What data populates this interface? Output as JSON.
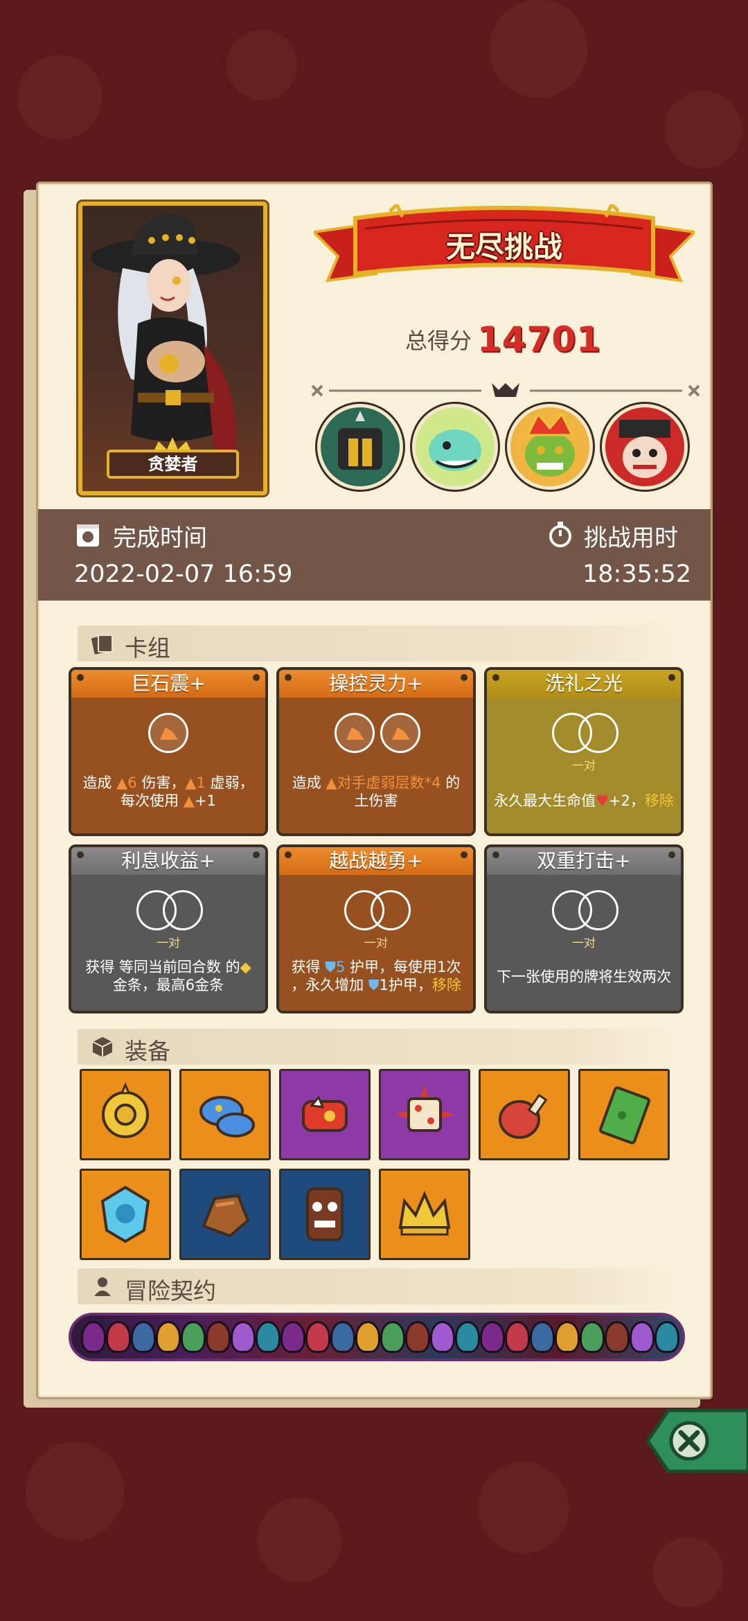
{
  "portrait": {
    "name": "贪婪者"
  },
  "banner": {
    "title": "无尽挑战"
  },
  "score": {
    "label": "总得分",
    "value": "14701"
  },
  "bosses": [
    "boss-helmet",
    "boss-dragon",
    "boss-goblin-king",
    "boss-jester"
  ],
  "time": {
    "finish_label": "完成时间",
    "finish_value": "2022-02-07 16:59",
    "duration_label": "挑战用时",
    "duration_value": "18:35:52"
  },
  "sections": {
    "deck": "卡组",
    "equipment": "装备",
    "contract": "冒险契约"
  },
  "cards": [
    {
      "title": "巨石震+",
      "color": "#97501f",
      "desc1a": "造成 ",
      "desc1b": "6",
      "desc1c": " 伤害，",
      "desc1d": "1",
      "desc1e": " 虚弱，",
      "desc2a": "每次使用 ",
      "desc2b": "+1"
    },
    {
      "title": "操控灵力+",
      "color": "#97501f",
      "desc1a": "造成 ",
      "desc1b": "对手虚弱层数*4",
      "desc1c": " 的",
      "desc2a": "土伤害"
    },
    {
      "title": "洗礼之光",
      "color": "#a38a2a",
      "pair": "一对",
      "desc1a": "永久最大生命值",
      "desc1b": "+2，",
      "desc1c": "移除"
    },
    {
      "title": "利息收益+",
      "color": "#585858",
      "pair": "一对",
      "desc1a": "获得 等同当前回合数 的",
      "desc2a": "金条，最高6金条"
    },
    {
      "title": "越战越勇+",
      "color": "#97501f",
      "pair": "一对",
      "desc1a": "获得 ",
      "desc1b": "5",
      "desc1c": " 护甲，每使用1次",
      "desc2a": "，永久增加 ",
      "desc2b": "1护甲，",
      "desc2c": "移除"
    },
    {
      "title": "双重打击+",
      "color": "#585858",
      "pair": "一对",
      "desc1a": "下一张使用的牌将生效两次"
    }
  ],
  "equipment": [
    "sun-amulet-icon",
    "blue-mushroom-icon",
    "red-bracer-icon",
    "spiked-dice-icon",
    "meat-leg-icon",
    "green-slime-card-icon",
    "ice-gem-icon",
    "rock-icon",
    "tiki-mask-icon",
    "crown-icon"
  ],
  "colors": {
    "accent": "#d42c26",
    "panel": "#f8f0d8",
    "timebar": "#735647"
  }
}
